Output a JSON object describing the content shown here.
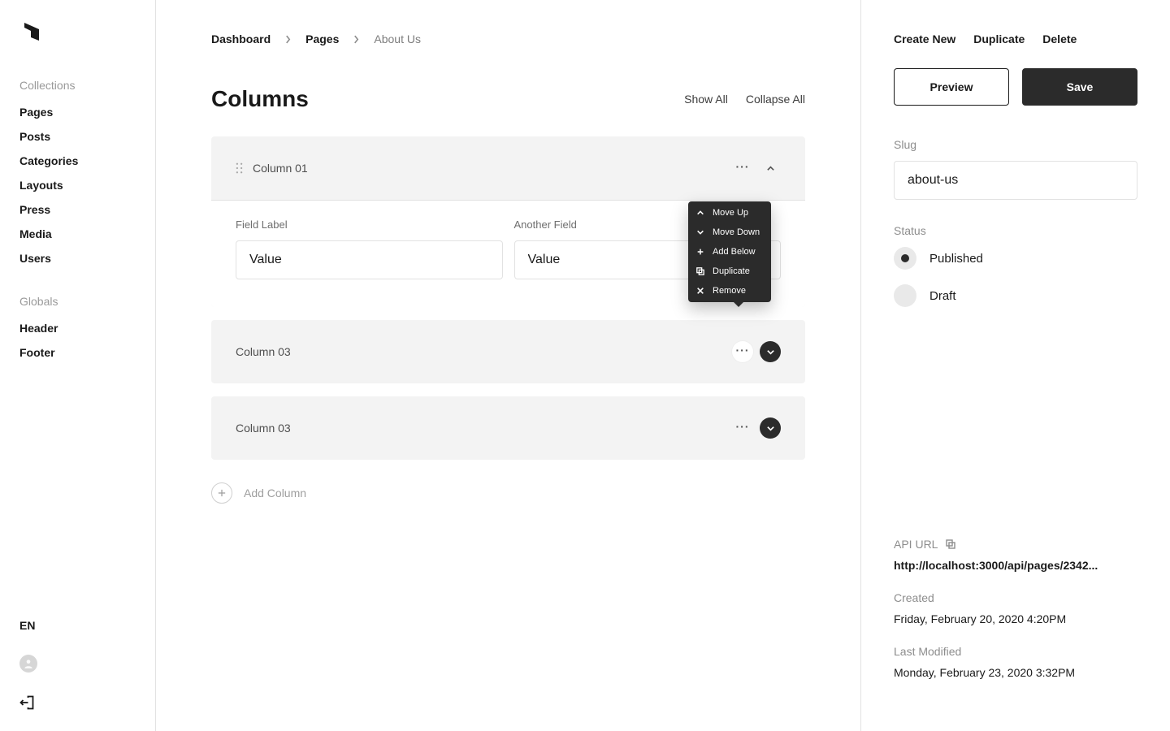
{
  "sidebar": {
    "collections_label": "Collections",
    "collections": [
      "Pages",
      "Posts",
      "Categories",
      "Layouts",
      "Press",
      "Media",
      "Users"
    ],
    "globals_label": "Globals",
    "globals": [
      "Header",
      "Footer"
    ],
    "lang": "EN"
  },
  "breadcrumb": {
    "items": [
      "Dashboard",
      "Pages",
      "About Us"
    ]
  },
  "main": {
    "title": "Columns",
    "show_all": "Show All",
    "collapse_all": "Collapse All",
    "add_label": "Add Column",
    "blocks": {
      "b0": {
        "title": "Column 01",
        "field1_label": "Field Label",
        "field1_value": "Value",
        "field2_label": "Another Field",
        "field2_value": "Value"
      },
      "b1": {
        "title": "Column 03"
      },
      "b2": {
        "title": "Column 03"
      }
    }
  },
  "ctx": {
    "move_up": "Move Up",
    "move_down": "Move Down",
    "add_below": "Add Below",
    "duplicate": "Duplicate",
    "remove": "Remove"
  },
  "right": {
    "create_new": "Create New",
    "duplicate": "Duplicate",
    "delete": "Delete",
    "preview": "Preview",
    "save": "Save",
    "slug_label": "Slug",
    "slug_value": "about-us",
    "status_label": "Status",
    "status_published": "Published",
    "status_draft": "Draft",
    "api_label": "API URL",
    "api_value": "http://localhost:3000/api/pages/2342...",
    "created_label": "Created",
    "created_value": "Friday, February 20, 2020 4:20PM",
    "modified_label": "Last Modified",
    "modified_value": "Monday, February 23, 2020 3:32PM"
  }
}
